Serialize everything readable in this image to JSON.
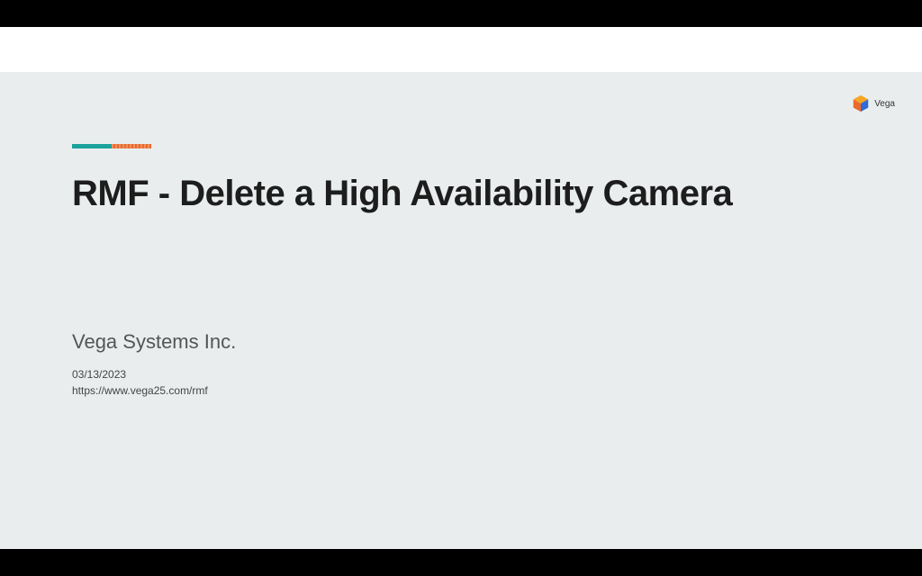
{
  "slide": {
    "title": "RMF - Delete a High Availability Camera",
    "company": "Vega Systems Inc.",
    "date": "03/13/2023",
    "url": "https://www.vega25.com/rmf"
  },
  "brand": {
    "label": "Vega"
  },
  "colors": {
    "accent_teal": "#1aa39a",
    "accent_orange": "#e96a2b",
    "slide_bg": "#e9edee"
  }
}
